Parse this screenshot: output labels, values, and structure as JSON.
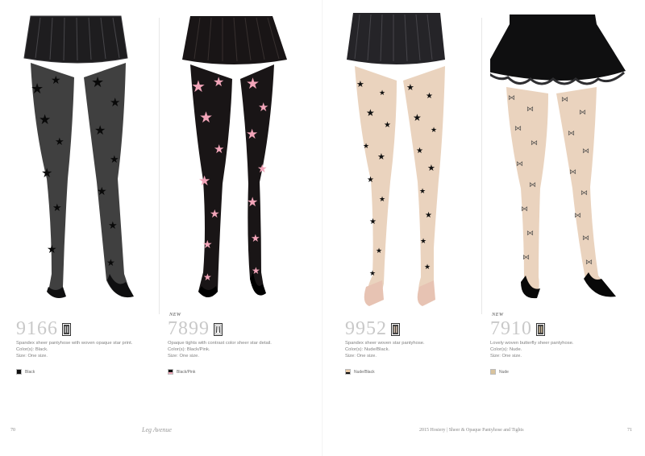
{
  "products": [
    {
      "sku": "9166",
      "is_new": false,
      "new_label": "",
      "description": "Spandex sheer pantyhose with woven opaque star print.",
      "colors": "Color(s): Black.",
      "size": "Size: One size.",
      "swatches": [
        {
          "label": "Black",
          "color": "#111111"
        }
      ]
    },
    {
      "sku": "7899",
      "is_new": true,
      "new_label": "NEW",
      "description": "Opaque tights with contrast color sheer star detail.",
      "colors": "Color(s): Black/Pink.",
      "size": "Size: One size.",
      "swatches": [
        {
          "label": "Black/Pink",
          "color": "#111111",
          "accent": "#f0a6b8"
        }
      ]
    },
    {
      "sku": "9952",
      "is_new": false,
      "new_label": "",
      "description": "Spandex sheer woven star pantyhose.",
      "colors": "Color(s): Nude/Black.",
      "size": "Size: One size.",
      "swatches": [
        {
          "label": "Nude/Black",
          "color": "#e8c9a6",
          "accent": "#111111"
        }
      ]
    },
    {
      "sku": "7910",
      "is_new": true,
      "new_label": "NEW",
      "description": "Lovely woven butterfly sheer pantyhose.",
      "colors": "Color(s): Nude.",
      "size": "Size: One size.",
      "swatches": [
        {
          "label": "Nude",
          "color": "#d9c39d"
        }
      ]
    }
  ],
  "footer": {
    "left_page_number": "70",
    "brand": "Leg Avenue",
    "running_head": "2015 Hosiery | Sheer & Opaque Pantyhose and Tights",
    "right_page_number": "71"
  },
  "colors": {
    "sheer_black": "#2b2b2b",
    "opaque_black": "#191516",
    "pink_star": "#f2a5b9",
    "nude": "#ead3be",
    "sku_gray": "#c9c9c9"
  }
}
